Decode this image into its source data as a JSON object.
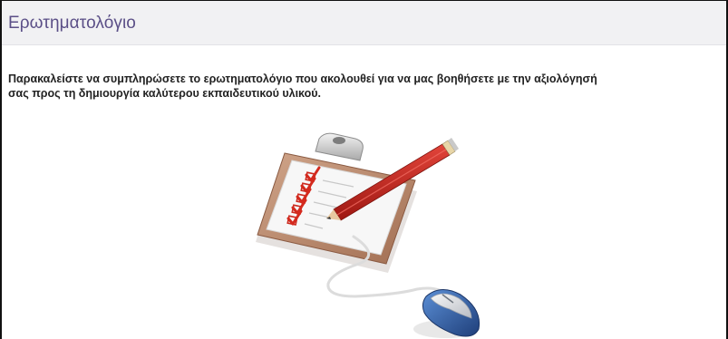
{
  "header": {
    "title": "Ερωτηματολόγιο"
  },
  "content": {
    "intro_line_1": "Παρακαλείστε να συμπληρώσετε το ερωτηματολόγιο που ακολουθεί για να μας βοηθήσετε με την αξιολόγησή",
    "intro_line_2": "σας προς τη δημιουργία καλύτερου εκπαιδευτικού υλικού."
  },
  "illustration": {
    "icon": "clipboard-checklist-pencil-mouse",
    "colors": {
      "board": "#b9896e",
      "paper": "#f4f4f4",
      "checks": "#d42a1e",
      "pencil": "#c9231b",
      "mouse_shell": "#2f5fa8"
    }
  }
}
